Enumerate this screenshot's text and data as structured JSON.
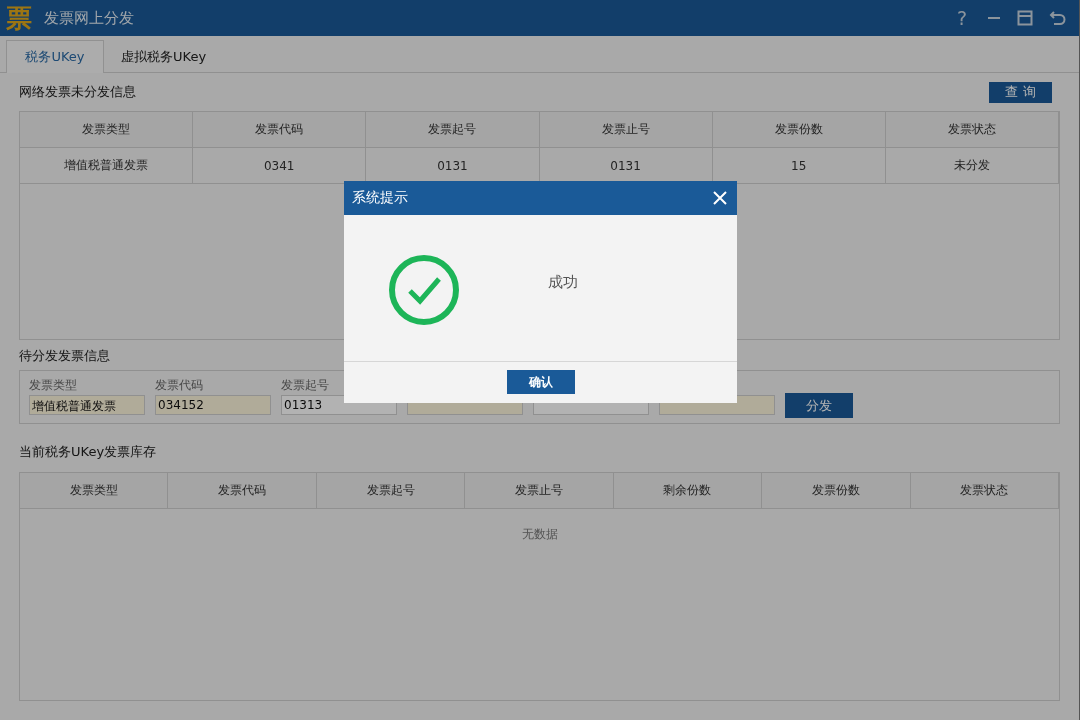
{
  "window": {
    "title": "发票网上分发",
    "logo": "票",
    "controls": [
      "?"
    ]
  },
  "tabs": [
    {
      "label": "税务UKey",
      "selected": true
    },
    {
      "label": "虚拟税务UKey",
      "selected": false
    }
  ],
  "network_section": {
    "title": "网络发票未分发信息",
    "query_button": "查 询",
    "table": {
      "columns": [
        "发票类型",
        "发票代码",
        "发票起号",
        "发票止号",
        "发票份数",
        "发票状态"
      ],
      "rows": [
        [
          "增值税普通发票",
          "0341",
          "0131",
          "0131",
          "15",
          "未分发"
        ]
      ]
    }
  },
  "pending_section": {
    "title": "待分发发票信息",
    "fields": [
      {
        "label": "发票类型",
        "value": "增值税普通发票",
        "highlighted": true
      },
      {
        "label": "发票代码",
        "value": "034152",
        "highlighted": true
      },
      {
        "label": "发票起号",
        "value": "01313",
        "highlighted": false
      },
      {
        "highlighted": true
      },
      {
        "highlighted": false
      },
      {
        "highlighted": true
      }
    ],
    "button": "分发"
  },
  "stock_section": {
    "title": "当前税务UKey发票库存",
    "table": {
      "columns": [
        "发票类型",
        "发票代码",
        "发票起号",
        "发票止号",
        "剩余份数",
        "发票份数",
        "发票状态"
      ],
      "empty_text": "无数据"
    }
  },
  "dialog": {
    "title": "系统提示",
    "kind": "success",
    "message": "成功",
    "button": "确认"
  }
}
